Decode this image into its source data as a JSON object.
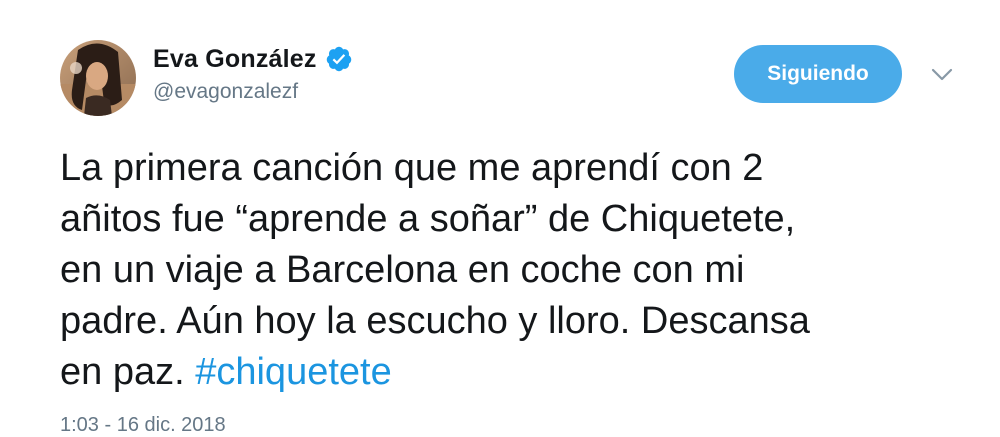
{
  "user": {
    "display_name": "Eva González",
    "handle": "@evagonzalezf",
    "avatar_icon": "profile-photo",
    "verified_icon": "verified-badge-icon"
  },
  "actions": {
    "follow_label": "Siguiendo",
    "menu_icon": "chevron-down-icon"
  },
  "tweet": {
    "lines": [
      "La primera canción que me aprendí con 2",
      "añitos fue “aprende a soñar” de Chiquetete,",
      "en un viaje a Barcelona en coche con mi",
      "padre. Aún hoy la escucho y lloro. Descansa"
    ],
    "last_line_prefix": "en paz. ",
    "hashtag": "#chiquetete",
    "timestamp": "1:03 - 16 dic. 2018"
  },
  "colors": {
    "accent": "#4aabe9",
    "hashtag": "#1b95e0",
    "secondary_text": "#657786",
    "primary_text": "#14171a"
  }
}
